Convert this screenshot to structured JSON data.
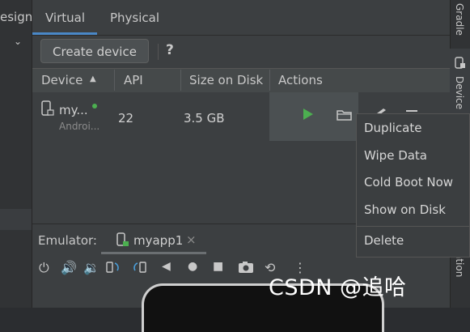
{
  "left_strip": {
    "label": "esign",
    "chevron": "⌄"
  },
  "tabs": [
    {
      "label": "Virtual",
      "active": true
    },
    {
      "label": "Physical",
      "active": false
    }
  ],
  "toolbar": {
    "create_label": "Create device",
    "help": "?"
  },
  "table": {
    "headers": [
      "Device",
      "API",
      "Size on Disk",
      "Actions"
    ],
    "rows": [
      {
        "name": "my...",
        "type": "Androi...",
        "api": "22",
        "size": "3.5 GB"
      }
    ]
  },
  "emulator": {
    "label": "Emulator:",
    "tab_name": "myapp1",
    "close": "×"
  },
  "right_strip": {
    "top": "Gradle",
    "mid": "Device M",
    "bottom": "ation"
  },
  "context_menu": [
    "Duplicate",
    "Wipe Data",
    "Cold Boot Now",
    "Show on Disk",
    "Delete"
  ],
  "watermark": "CSDN @追哈",
  "colors": {
    "accent": "#4a88c7",
    "play": "#4caf50",
    "status": "#4caf50",
    "background": "#3c3f41"
  }
}
